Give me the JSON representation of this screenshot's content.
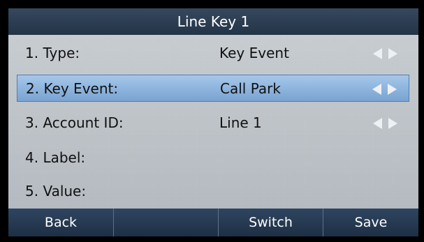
{
  "header": {
    "title": "Line Key 1"
  },
  "rows": [
    {
      "label": "1. Type:",
      "value": "Key Event",
      "arrows": true,
      "selected": false
    },
    {
      "label": "2. Key Event:",
      "value": "Call Park",
      "arrows": true,
      "selected": true
    },
    {
      "label": "3. Account ID:",
      "value": "Line 1",
      "arrows": true,
      "selected": false
    },
    {
      "label": "4. Label:",
      "value": "",
      "arrows": false,
      "selected": false
    },
    {
      "label": "5. Value:",
      "value": "",
      "arrows": false,
      "selected": false
    }
  ],
  "softkeys": [
    "Back",
    "",
    "Switch",
    "Save"
  ],
  "colors": {
    "title_bg": "#2c3e54",
    "selected_bg": "#8fb6e0",
    "content_bg": "#bec3c8",
    "softkey_bg": "#26384f"
  },
  "icons": {
    "left": "left-triangle-icon",
    "right": "right-triangle-icon"
  }
}
